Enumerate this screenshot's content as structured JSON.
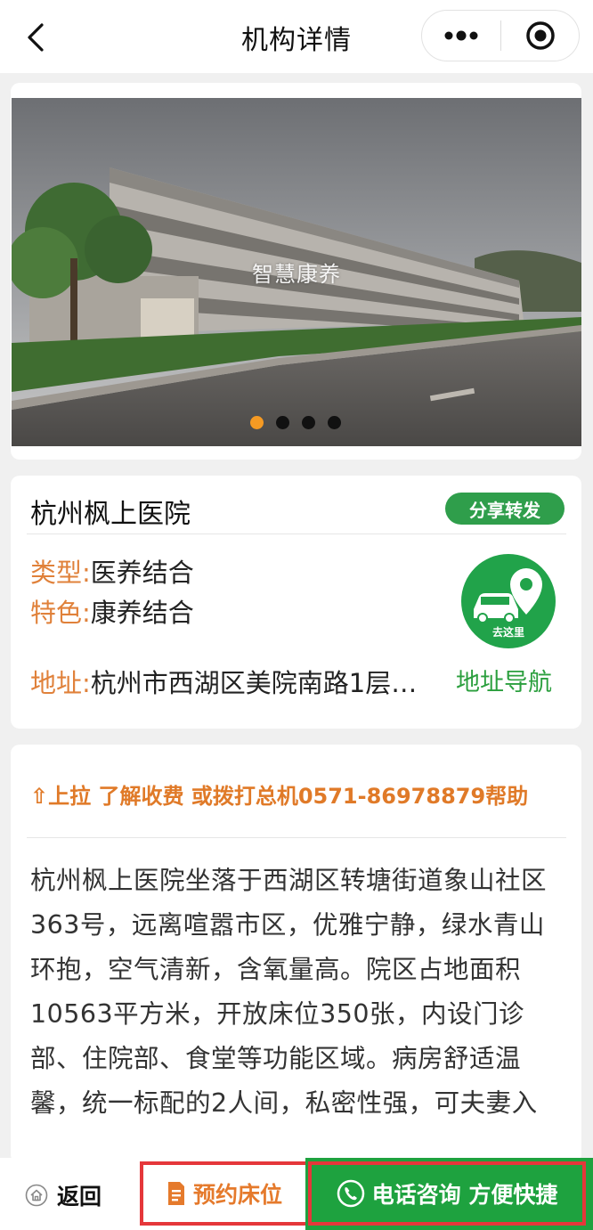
{
  "header": {
    "title": "机构详情",
    "back_icon": "chevron-left-icon",
    "more_icon": "more-dots-icon",
    "record_icon": "record-target-icon"
  },
  "banner": {
    "caption": "智慧康养",
    "slide_count": 4,
    "active_index": 0
  },
  "institution": {
    "name": "杭州枫上医院",
    "share_label": "分享转发",
    "type_label": "类型:",
    "type_value": "医养结合",
    "feature_label": "特色:",
    "feature_value": "康养结合",
    "address_label": "地址:",
    "address_value": "杭州市西湖区美院南路1层…",
    "go_label": "去这里",
    "nav_label": "地址导航"
  },
  "description": {
    "tip": "⇧上拉 了解收费 或拨打总机0571-86978879帮助",
    "text": "杭州枫上医院坐落于西湖区转塘街道象山社区363号，远离喧嚣市区，优雅宁静，绿水青山环抱，空气清新，含氧量高。院区占地面积10563平方米，开放床位350张，内设门诊部、住院部、食堂等功能区域。病房舒适温馨，统一标配的2人间，私密性强，可夫妻入"
  },
  "bottom_bar": {
    "back_label": "返回",
    "reserve_label": "预约床位",
    "call_label": "电话咨询 方便快捷"
  },
  "colors": {
    "accent_orange": "#e0813a",
    "green": "#2f9e4b",
    "red_outline": "#e5373a",
    "dot_active": "#f59a23"
  }
}
